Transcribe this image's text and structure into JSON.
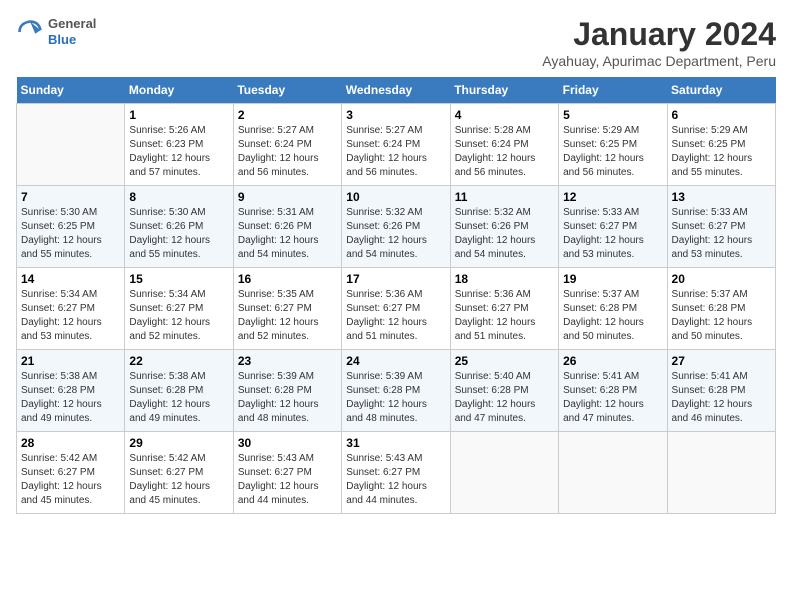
{
  "logo": {
    "general": "General",
    "blue": "Blue"
  },
  "header": {
    "title": "January 2024",
    "location": "Ayahuay, Apurimac Department, Peru"
  },
  "weekdays": [
    "Sunday",
    "Monday",
    "Tuesday",
    "Wednesday",
    "Thursday",
    "Friday",
    "Saturday"
  ],
  "weeks": [
    [
      {
        "day": "",
        "sunrise": "",
        "sunset": "",
        "daylight": ""
      },
      {
        "day": "1",
        "sunrise": "Sunrise: 5:26 AM",
        "sunset": "Sunset: 6:23 PM",
        "daylight": "Daylight: 12 hours and 57 minutes."
      },
      {
        "day": "2",
        "sunrise": "Sunrise: 5:27 AM",
        "sunset": "Sunset: 6:24 PM",
        "daylight": "Daylight: 12 hours and 56 minutes."
      },
      {
        "day": "3",
        "sunrise": "Sunrise: 5:27 AM",
        "sunset": "Sunset: 6:24 PM",
        "daylight": "Daylight: 12 hours and 56 minutes."
      },
      {
        "day": "4",
        "sunrise": "Sunrise: 5:28 AM",
        "sunset": "Sunset: 6:24 PM",
        "daylight": "Daylight: 12 hours and 56 minutes."
      },
      {
        "day": "5",
        "sunrise": "Sunrise: 5:29 AM",
        "sunset": "Sunset: 6:25 PM",
        "daylight": "Daylight: 12 hours and 56 minutes."
      },
      {
        "day": "6",
        "sunrise": "Sunrise: 5:29 AM",
        "sunset": "Sunset: 6:25 PM",
        "daylight": "Daylight: 12 hours and 55 minutes."
      }
    ],
    [
      {
        "day": "7",
        "sunrise": "Sunrise: 5:30 AM",
        "sunset": "Sunset: 6:25 PM",
        "daylight": "Daylight: 12 hours and 55 minutes."
      },
      {
        "day": "8",
        "sunrise": "Sunrise: 5:30 AM",
        "sunset": "Sunset: 6:26 PM",
        "daylight": "Daylight: 12 hours and 55 minutes."
      },
      {
        "day": "9",
        "sunrise": "Sunrise: 5:31 AM",
        "sunset": "Sunset: 6:26 PM",
        "daylight": "Daylight: 12 hours and 54 minutes."
      },
      {
        "day": "10",
        "sunrise": "Sunrise: 5:32 AM",
        "sunset": "Sunset: 6:26 PM",
        "daylight": "Daylight: 12 hours and 54 minutes."
      },
      {
        "day": "11",
        "sunrise": "Sunrise: 5:32 AM",
        "sunset": "Sunset: 6:26 PM",
        "daylight": "Daylight: 12 hours and 54 minutes."
      },
      {
        "day": "12",
        "sunrise": "Sunrise: 5:33 AM",
        "sunset": "Sunset: 6:27 PM",
        "daylight": "Daylight: 12 hours and 53 minutes."
      },
      {
        "day": "13",
        "sunrise": "Sunrise: 5:33 AM",
        "sunset": "Sunset: 6:27 PM",
        "daylight": "Daylight: 12 hours and 53 minutes."
      }
    ],
    [
      {
        "day": "14",
        "sunrise": "Sunrise: 5:34 AM",
        "sunset": "Sunset: 6:27 PM",
        "daylight": "Daylight: 12 hours and 53 minutes."
      },
      {
        "day": "15",
        "sunrise": "Sunrise: 5:34 AM",
        "sunset": "Sunset: 6:27 PM",
        "daylight": "Daylight: 12 hours and 52 minutes."
      },
      {
        "day": "16",
        "sunrise": "Sunrise: 5:35 AM",
        "sunset": "Sunset: 6:27 PM",
        "daylight": "Daylight: 12 hours and 52 minutes."
      },
      {
        "day": "17",
        "sunrise": "Sunrise: 5:36 AM",
        "sunset": "Sunset: 6:27 PM",
        "daylight": "Daylight: 12 hours and 51 minutes."
      },
      {
        "day": "18",
        "sunrise": "Sunrise: 5:36 AM",
        "sunset": "Sunset: 6:27 PM",
        "daylight": "Daylight: 12 hours and 51 minutes."
      },
      {
        "day": "19",
        "sunrise": "Sunrise: 5:37 AM",
        "sunset": "Sunset: 6:28 PM",
        "daylight": "Daylight: 12 hours and 50 minutes."
      },
      {
        "day": "20",
        "sunrise": "Sunrise: 5:37 AM",
        "sunset": "Sunset: 6:28 PM",
        "daylight": "Daylight: 12 hours and 50 minutes."
      }
    ],
    [
      {
        "day": "21",
        "sunrise": "Sunrise: 5:38 AM",
        "sunset": "Sunset: 6:28 PM",
        "daylight": "Daylight: 12 hours and 49 minutes."
      },
      {
        "day": "22",
        "sunrise": "Sunrise: 5:38 AM",
        "sunset": "Sunset: 6:28 PM",
        "daylight": "Daylight: 12 hours and 49 minutes."
      },
      {
        "day": "23",
        "sunrise": "Sunrise: 5:39 AM",
        "sunset": "Sunset: 6:28 PM",
        "daylight": "Daylight: 12 hours and 48 minutes."
      },
      {
        "day": "24",
        "sunrise": "Sunrise: 5:39 AM",
        "sunset": "Sunset: 6:28 PM",
        "daylight": "Daylight: 12 hours and 48 minutes."
      },
      {
        "day": "25",
        "sunrise": "Sunrise: 5:40 AM",
        "sunset": "Sunset: 6:28 PM",
        "daylight": "Daylight: 12 hours and 47 minutes."
      },
      {
        "day": "26",
        "sunrise": "Sunrise: 5:41 AM",
        "sunset": "Sunset: 6:28 PM",
        "daylight": "Daylight: 12 hours and 47 minutes."
      },
      {
        "day": "27",
        "sunrise": "Sunrise: 5:41 AM",
        "sunset": "Sunset: 6:28 PM",
        "daylight": "Daylight: 12 hours and 46 minutes."
      }
    ],
    [
      {
        "day": "28",
        "sunrise": "Sunrise: 5:42 AM",
        "sunset": "Sunset: 6:27 PM",
        "daylight": "Daylight: 12 hours and 45 minutes."
      },
      {
        "day": "29",
        "sunrise": "Sunrise: 5:42 AM",
        "sunset": "Sunset: 6:27 PM",
        "daylight": "Daylight: 12 hours and 45 minutes."
      },
      {
        "day": "30",
        "sunrise": "Sunrise: 5:43 AM",
        "sunset": "Sunset: 6:27 PM",
        "daylight": "Daylight: 12 hours and 44 minutes."
      },
      {
        "day": "31",
        "sunrise": "Sunrise: 5:43 AM",
        "sunset": "Sunset: 6:27 PM",
        "daylight": "Daylight: 12 hours and 44 minutes."
      },
      {
        "day": "",
        "sunrise": "",
        "sunset": "",
        "daylight": ""
      },
      {
        "day": "",
        "sunrise": "",
        "sunset": "",
        "daylight": ""
      },
      {
        "day": "",
        "sunrise": "",
        "sunset": "",
        "daylight": ""
      }
    ]
  ]
}
